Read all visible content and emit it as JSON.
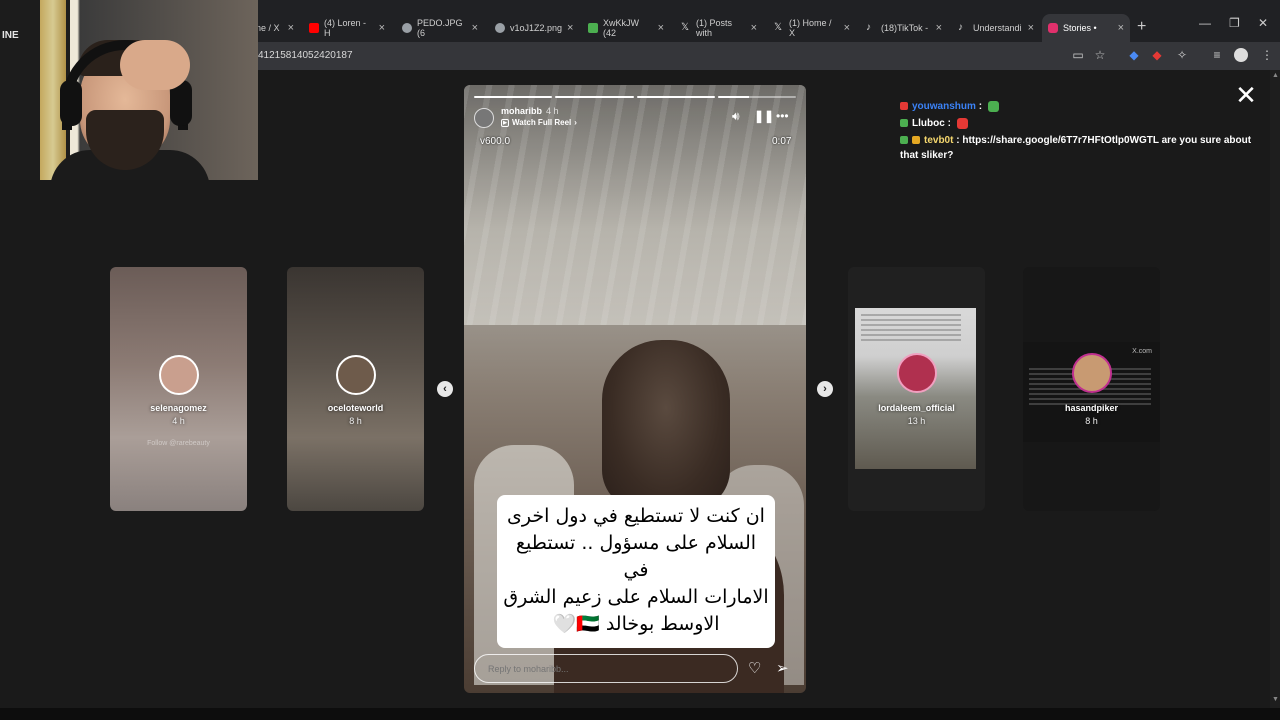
{
  "browser": {
    "tabs": [
      {
        "label": "ne / X",
        "favicon_color": "#000000"
      },
      {
        "label": "(4) Loren - H",
        "favicon_color": "#ff0000"
      },
      {
        "label": "PEDO.JPG (6",
        "favicon_color": "#9aa0a6"
      },
      {
        "label": "v1oJ1Z2.png",
        "favicon_color": "#9aa0a6"
      },
      {
        "label": "XwKkJW (42",
        "favicon_color": "#4caf50"
      },
      {
        "label": "(1) Posts with",
        "favicon_color": "#000000"
      },
      {
        "label": "(1) Home / X",
        "favicon_color": "#000000"
      },
      {
        "label": "(18)TikTok -",
        "favicon_color": "#000000"
      },
      {
        "label": "Understandi",
        "favicon_color": "#000000"
      },
      {
        "label": "Stories •",
        "favicon_color": "#e1306c",
        "active": true
      }
    ],
    "new_tab_label": "+",
    "url": "41215814052420187"
  },
  "story": {
    "username": "moharibb",
    "time": "4 h",
    "watch_full_reel": "Watch Full Reel",
    "overlay_left": "v600.0",
    "overlay_right": "0:07",
    "progress": [
      1,
      1,
      1,
      0.4
    ],
    "caption": "ان كنت لا تستطيع في دول اخرى\nالسلام على مسؤول .. تستطيع في\nالامارات السلام على زعيم الشرق\nالاوسط بوخالد 🇦🇪🤍",
    "reply_placeholder": "Reply to moharibb..."
  },
  "side_stories": [
    {
      "username": "selenagomez",
      "time": "4 h",
      "faint_text": "Follow @rarebeauty"
    },
    {
      "username": "oceloteworld",
      "time": "8 h"
    },
    {
      "username": "lordaleem_official",
      "time": "13 h"
    },
    {
      "username": "hasandpiker",
      "time": "8 h",
      "card_label": "X.com"
    }
  ],
  "chat": [
    {
      "user": "youwanshum",
      "user_color": "#3b82f6",
      "badge_color": "#e53935",
      "message": ":",
      "emote_color": "#4caf50"
    },
    {
      "user": "Lluboc",
      "user_color": "#ffffff",
      "badge_color": "#4caf50",
      "message": ":",
      "emote_color": "#e53935"
    },
    {
      "user": "tevb0t",
      "user_color": "#f5d76e",
      "badge_color": "#4caf50",
      "message": ": https://share.google/6T7r7HFtOtlp0WGTL are you sure about that sliker?"
    }
  ],
  "webcam": {
    "wall_text": "INE"
  },
  "icons": {
    "close": "close-icon",
    "mute": "speaker-icon",
    "pause": "pause-icon",
    "more": "more-icon",
    "like": "heart-icon",
    "share": "send-icon"
  }
}
